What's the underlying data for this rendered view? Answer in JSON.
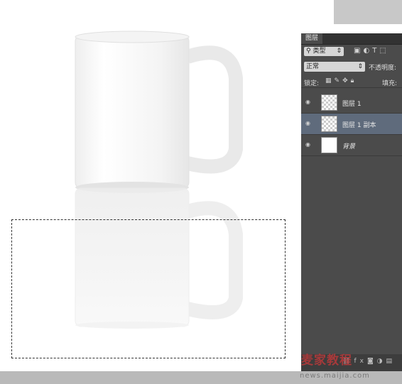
{
  "panel": {
    "tab_label": "图层",
    "filter_label": "类型",
    "blend_mode": "正常",
    "opacity_label": "不透明度:",
    "lock_label": "锁定:",
    "fill_label": "填充:",
    "layers": [
      {
        "name": "图层 1",
        "selected": false
      },
      {
        "name": "图层 1 副本",
        "selected": true
      },
      {
        "name": "背景",
        "selected": false
      }
    ]
  },
  "watermark": {
    "brand": "麦家教程",
    "url": "news.maijia.com"
  },
  "colors": {
    "panel_bg": "#4b4b4b",
    "selected_layer": "#5f6b7c"
  }
}
